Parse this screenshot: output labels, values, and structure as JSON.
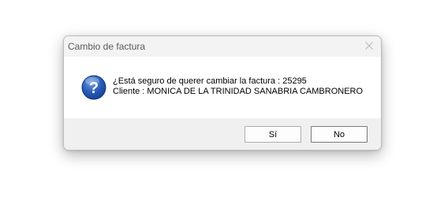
{
  "window": {
    "title": "Cambio de factura",
    "close_icon": "close-icon"
  },
  "message": {
    "icon": "question-icon",
    "line1": "¿Está seguro de querer cambiar la factura : 25295",
    "line2": "Cliente : MONICA DE LA TRINIDAD SANABRIA CAMBRONERO"
  },
  "buttons": {
    "yes_label": "Sí",
    "no_label": "No"
  },
  "colors": {
    "icon_blue": "#1f4fa8",
    "titlebar_bg": "#f3f3f3",
    "footer_bg": "#f0f0f0"
  }
}
